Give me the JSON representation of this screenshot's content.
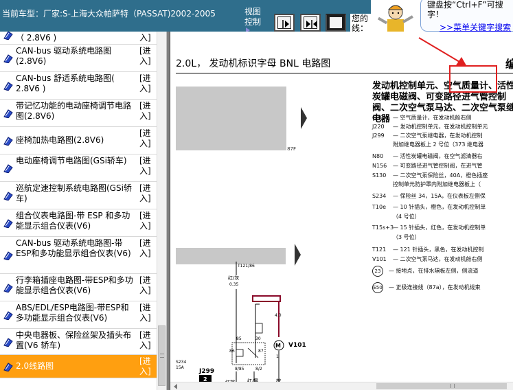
{
  "topbar": {
    "title": "当前车型：厂家:S-上海大众帕萨特（PASSAT)2002-2005",
    "view_control": "视图控制",
    "mine_label": "您的线："
  },
  "help": {
    "hint": "键盘按“Ctrl+F”可搜字！",
    "hotkey_link": ">>菜单关键字搜索"
  },
  "sidebar": {
    "items": [
      {
        "label": "（ 2.8V6 )",
        "enter": "入]"
      },
      {
        "label": "CAN-bus 驱动系统电路图(2.8V6)",
        "enter": "[进入]"
      },
      {
        "label": "CAN-bus 舒适系统电路图( 2.8V6 )",
        "enter": "[进入]"
      },
      {
        "label": "带记忆功能的电动座椅调节电路图(2.8V6)",
        "enter": "[进入]"
      },
      {
        "label": "座椅加热电路图(2.8V6)",
        "enter": "[进入]"
      },
      {
        "label": "电动座椅调节电路图(GSi轿车)",
        "enter": "[进入]"
      },
      {
        "label": "巡航定速控制系统电路图(GSi轿车)",
        "enter": "[进入]"
      },
      {
        "label": "组合仪表电路图-带 ESP 和多功能显示组合仪表(V6)",
        "enter": "[进入]"
      },
      {
        "label": "CAN-bus 驱动系统电路图-带ESP和多功能显示组合仪表(V6)",
        "enter": "[进入]"
      },
      {
        "label": "行李箱插座电路图-带ESP和多功能显示组合仪表(V6)",
        "enter": "[进入]"
      },
      {
        "label": "ABS/EDL/ESP电路图-带ESP和多功能显示组合仪表(V6)",
        "enter": "[进入]"
      },
      {
        "label": "中央电器板、保险丝架及插头布置(V6 轿车)",
        "enter": "[进入]"
      },
      {
        "label": "2.0线路图",
        "enter": "[进入]"
      }
    ]
  },
  "content": {
    "sheet_title": "2.0L， 发动机标识字母 BNL 电路图",
    "sheet_title_right": "编",
    "legend_head": "发动机控制单元、空气质量计、活性炭罐电磁阀、可变路径进气管控制阀、二次空气泵马达、二次空气泵继电器",
    "gray_tag": "87F",
    "legend_rows": [
      {
        "code": "G70",
        "text": "— 空气质量计，在发动机舱右侧"
      },
      {
        "code": "J220",
        "text": "— 发动机控制单元，在发动机控制单元"
      },
      {
        "code": "J299",
        "text": "— 二次空气泵继电器，在发动机控制"
      },
      {
        "code": "",
        "text": "附加继电器板上 2 号位（373 继电器"
      },
      {
        "code": "N80",
        "text": "— 活性炭罐电磁阀，在空气滤清器右"
      },
      {
        "code": "N156",
        "text": "— 可变路径进气管控制阀，在进气管"
      },
      {
        "code": "S130",
        "text": "— 二次空气泵保险丝，40A，橙色插座"
      },
      {
        "code": "",
        "text": "控制单元防护罩内附加继电器板上（"
      },
      {
        "code": "S234",
        "text": "— 保险丝 34，15A，在仪表板左侧保"
      },
      {
        "code": "T10e",
        "text": "— 10 针插头，橙色，在发动机控制单"
      },
      {
        "code": "",
        "text": "（4 号位）"
      },
      {
        "code": "T15s+3",
        "text": "— 15 针插头，红色，在发动机控制单"
      },
      {
        "code": "",
        "text": "（3 号位）"
      },
      {
        "code": "T121",
        "text": "— 121 针插头，黑色，在发动机控制"
      },
      {
        "code": "V101",
        "text": "— 二次空气泵马达，在发动机舱右侧"
      }
    ],
    "ground_rows": [
      {
        "code": "23",
        "text": "— 接地点，在排水隔板左侧，侧流道"
      },
      {
        "code": "E50",
        "text": "— 正极连接线（87a），在发动机线束"
      }
    ],
    "schematic": {
      "top_label": "T121/86",
      "wire1": "红/灰",
      "wire1_size": "0.35",
      "relay": "J299",
      "relay_num": "2",
      "motor": "V101",
      "fuse": "S234",
      "fuse_sub": "15A",
      "pin_left": "85",
      "pin_left2": "30",
      "pin_right": "87",
      "pin_right2": "86",
      "wire_bot1": "红棕",
      "wire_bot1_size": "0.5",
      "wire_bot2": "红/黑",
      "wire_bot3": "棕",
      "size_40": "4.0",
      "pin_a": "8/85",
      "pin_b": "8/2",
      "pin_c": "6/1",
      "pin_d": "4/1",
      "pin_e": "2",
      "pin_f": "1"
    }
  }
}
